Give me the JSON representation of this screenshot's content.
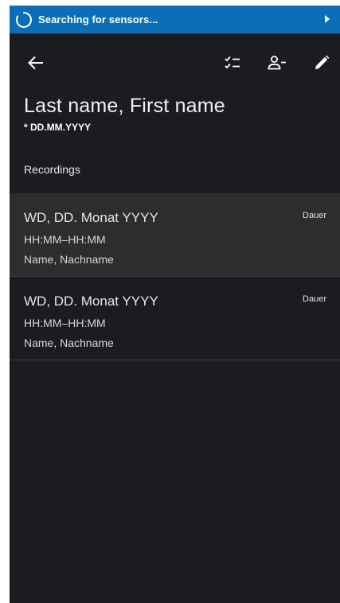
{
  "status_bar": {
    "text": "Searching for sensors...",
    "spinner_icon": "spinner-icon",
    "chevron_icon": "chevron-right-icon",
    "color": "#0a6fb6"
  },
  "toolbar": {
    "back_icon": "arrow-back-icon",
    "checklist_icon": "checklist-icon",
    "person_icon": "person-remove-icon",
    "edit_icon": "pencil-icon"
  },
  "patient": {
    "name": "Last name, First name",
    "birth_date": "* DD.MM.YYYY"
  },
  "recordings": {
    "header": "Recordings",
    "items": [
      {
        "date": "WD, DD. Monat YYYY",
        "time": "HH:MM–HH:MM",
        "person": "Name, Nachname",
        "duration": "Dauer",
        "selected": true
      },
      {
        "date": "WD, DD. Monat YYYY",
        "time": "HH:MM–HH:MM",
        "person": "Name, Nachname",
        "duration": "Dauer",
        "selected": false
      }
    ]
  },
  "colors": {
    "background": "#1c1c20",
    "selected_row": "#2d2d30",
    "accent": "#0a6fb6"
  }
}
